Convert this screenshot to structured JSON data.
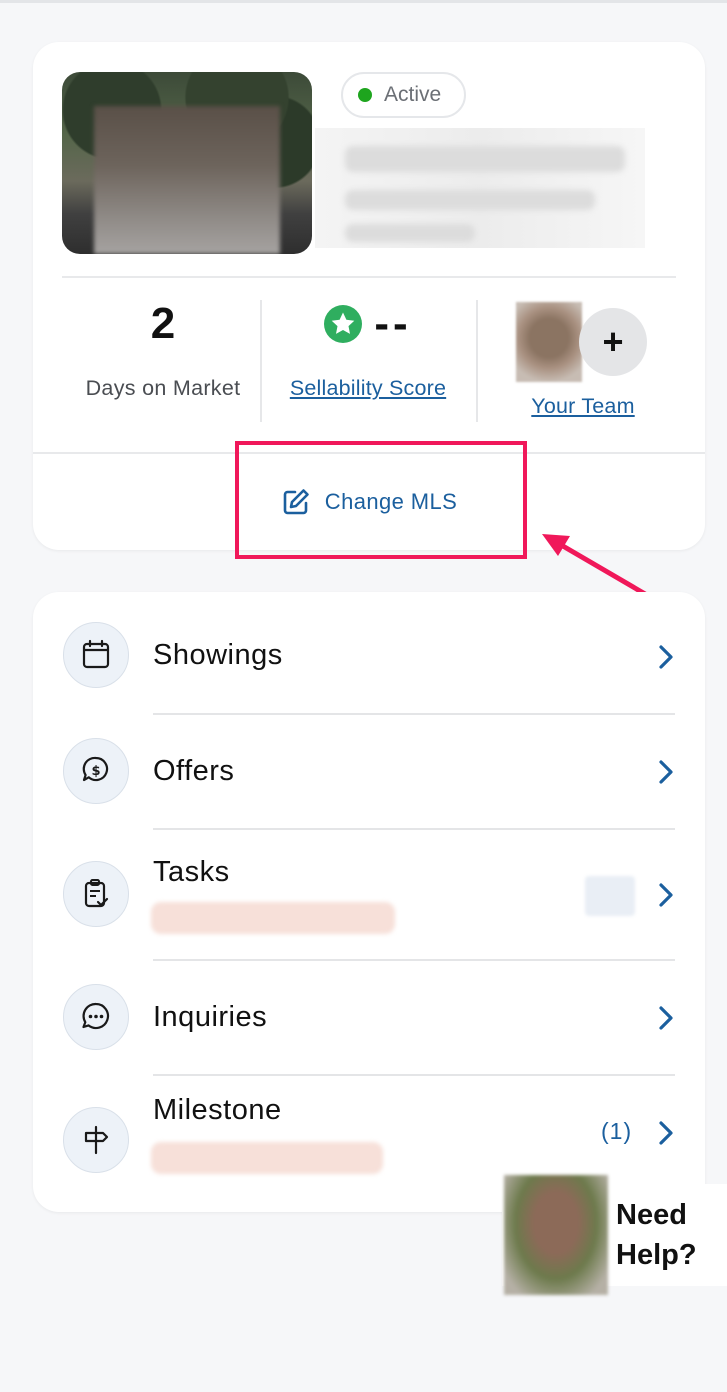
{
  "listing": {
    "status": "Active",
    "status_color": "#1ea51e",
    "days_on_market_value": "2",
    "days_on_market_label": "Days on Market",
    "sellability_value": "--",
    "sellability_label": "Sellability Score",
    "team_label": "Your Team",
    "add_team_symbol": "+",
    "change_mls_label": "Change MLS"
  },
  "menu": {
    "items": [
      {
        "label": "Showings",
        "icon": "calendar-icon"
      },
      {
        "label": "Offers",
        "icon": "dollar-chat-icon"
      },
      {
        "label": "Tasks",
        "icon": "clipboard-check-icon"
      },
      {
        "label": "Inquiries",
        "icon": "chat-bubble-icon"
      },
      {
        "label": "Milestone",
        "icon": "signpost-icon",
        "count": "(1)"
      }
    ]
  },
  "help": {
    "line1": "Need",
    "line2": "Help?"
  },
  "colors": {
    "accent": "#1b5f9e",
    "annotation": "#f0185a",
    "score_green": "#2fae5f"
  }
}
